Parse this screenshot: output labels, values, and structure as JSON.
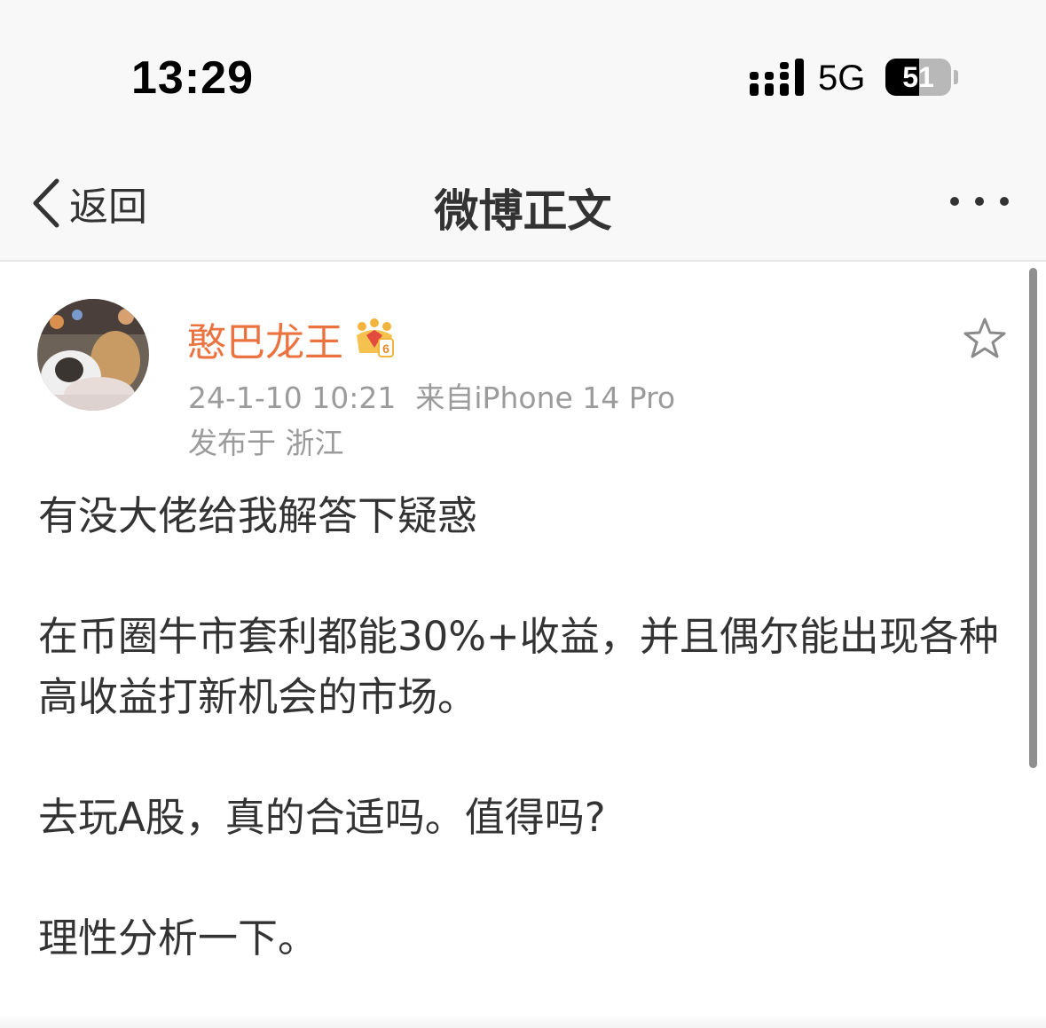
{
  "status_bar": {
    "time": "13:29",
    "network": "5G",
    "battery_level": "51",
    "battery_fraction": 0.51,
    "signal_icon": "signal-bars-icon"
  },
  "nav": {
    "back_label": "返回",
    "title": "微博正文",
    "more_icon": "ellipsis-icon"
  },
  "post": {
    "author": "憨巴龙王",
    "vip_level": "6",
    "timestamp": "24-1-10 10:21",
    "source": "来自iPhone 14 Pro",
    "location": "发布于 浙江",
    "paragraphs": [
      "有没大佬给我解答下疑惑",
      "在币圈牛市套利都能30%+收益，并且偶尔能出现各种高收益打新机会的市场。",
      "去玩A股，真的合适吗。值得吗?",
      "理性分析一下。"
    ]
  },
  "colors": {
    "username": "#eb7340",
    "meta_text": "#9b9b9b",
    "body_text": "#333333",
    "bar_background": "#f8f8f8"
  }
}
